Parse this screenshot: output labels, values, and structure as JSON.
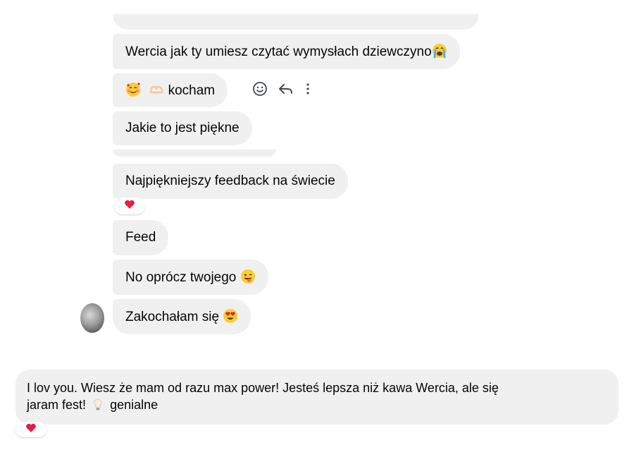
{
  "messages": [
    {
      "id": "m1",
      "text": "Wercia jak ty umiesz czytać wymysłach dziewczyno",
      "emoji": "loudly-crying-face"
    },
    {
      "id": "m2",
      "text": "kocham",
      "emoji_prefix": [
        "smiling-face-with-hearts",
        "heart-hands"
      ]
    },
    {
      "id": "m3",
      "text": "Jakie to jest piękne"
    },
    {
      "id": "m4",
      "text": "Najpiękniejszy feedback na świecie",
      "reaction": "heart"
    },
    {
      "id": "m5",
      "text": "Feed"
    },
    {
      "id": "m6",
      "text": "No oprócz twojego",
      "emoji": "winking-face-with-tongue"
    },
    {
      "id": "m7",
      "text": "Zakochałam się",
      "emoji": "smiling-face-with-heart-eyes"
    },
    {
      "id": "m8",
      "text_line1": "I lov you. Wiesz że mam od razu max power! Jesteś lepsza niż kawa Wercia, ale się",
      "text_line2_a": "jaram fest!",
      "text_line2_b": "genialne",
      "inline_emoji": "light-bulb",
      "reaction": "heart"
    }
  ],
  "hover_actions": [
    "react-icon",
    "reply-icon",
    "more-icon"
  ],
  "colors": {
    "bubble": "#f0f0f0",
    "text": "#050505",
    "heart": "#e41e3f",
    "background": "#ffffff",
    "icon": "#444950"
  }
}
